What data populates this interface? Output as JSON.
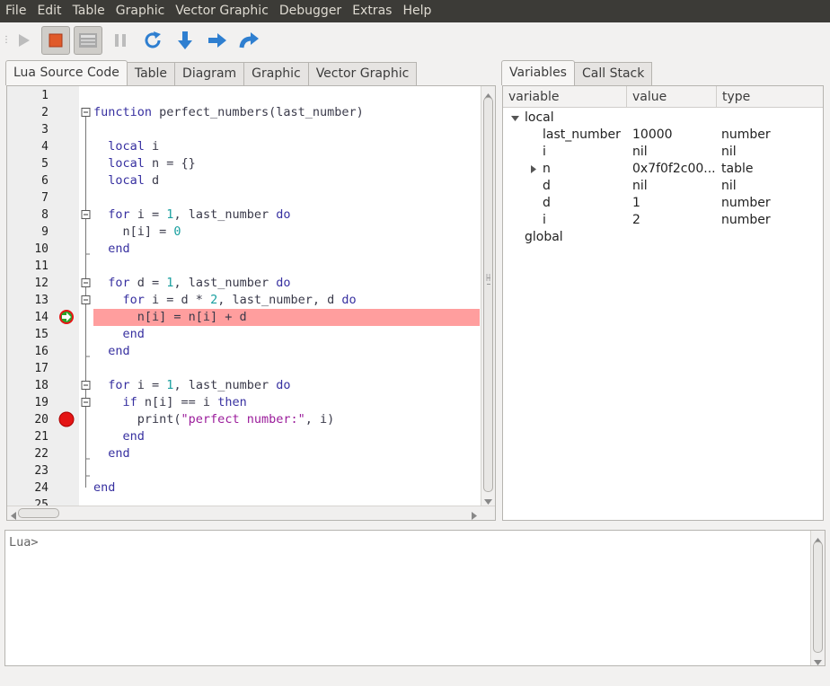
{
  "menubar": {
    "items": [
      "File",
      "Edit",
      "Table",
      "Graphic",
      "Vector Graphic",
      "Debugger",
      "Extras",
      "Help"
    ]
  },
  "toolbar": {
    "buttons": [
      {
        "icon": "play-icon",
        "enabled": false
      },
      {
        "icon": "stop-icon",
        "enabled": true
      },
      {
        "icon": "step-display-icon",
        "enabled": true,
        "pressed": true
      },
      {
        "icon": "pause-icon",
        "enabled": false
      },
      {
        "icon": "restart-icon",
        "enabled": true
      },
      {
        "icon": "step-into-icon",
        "enabled": true
      },
      {
        "icon": "step-over-icon",
        "enabled": true
      },
      {
        "icon": "step-out-icon",
        "enabled": true
      }
    ]
  },
  "editor_tabs": [
    "Lua Source Code",
    "Table",
    "Diagram",
    "Graphic",
    "Vector Graphic"
  ],
  "right_tabs": [
    "Variables",
    "Call Stack"
  ],
  "editor": {
    "line_numbers": [
      "1",
      "2",
      "3",
      "4",
      "5",
      "6",
      "7",
      "8",
      "9",
      "10",
      "11",
      "12",
      "13",
      "14",
      "15",
      "16",
      "17",
      "18",
      "19",
      "20",
      "21",
      "22",
      "23",
      "24",
      "25"
    ],
    "current_line": "14",
    "breakpoint_line": "20",
    "lines": [
      "",
      "function perfect_numbers(last_number)",
      "",
      "  local i",
      "  local n = {}",
      "  local d",
      "",
      "  for i = 1, last_number do",
      "    n[i] = 0",
      "  end",
      "",
      "  for d = 1, last_number do",
      "    for i = d * 2, last_number, d do",
      "      n[i] = n[i] + d",
      "    end",
      "  end",
      "",
      "  for i = 1, last_number do",
      "    if n[i] == i then",
      "      print(\"perfect number:\", i)",
      "    end",
      "  end",
      "",
      "end",
      ""
    ]
  },
  "variables": {
    "headers": [
      "variable",
      "value",
      "type"
    ],
    "local_label": "local",
    "global_label": "global",
    "rows": [
      {
        "name": "last_number",
        "value": "10000",
        "type": "number"
      },
      {
        "name": "i",
        "value": "nil",
        "type": "nil"
      },
      {
        "name": "n",
        "value": "0x7f0f2c00...",
        "type": "table"
      },
      {
        "name": "d",
        "value": "nil",
        "type": "nil"
      },
      {
        "name": "d",
        "value": "1",
        "type": "number"
      },
      {
        "name": "i",
        "value": "2",
        "type": "number"
      }
    ]
  },
  "console": {
    "prompt": "Lua>"
  }
}
